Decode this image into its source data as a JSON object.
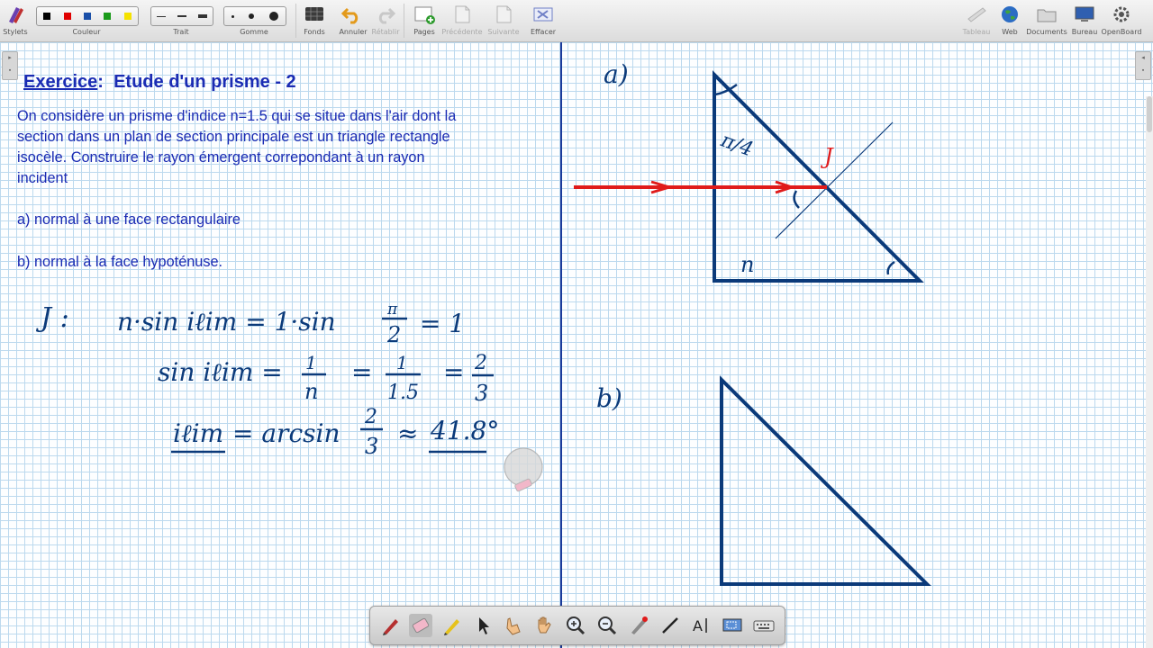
{
  "toolbar": {
    "stylets_label": "Stylets",
    "couleur_label": "Couleur",
    "couleur_swatches": [
      "#000000",
      "#e00000",
      "#1a4fa8",
      "#1a9a1a",
      "#f5e200"
    ],
    "trait_label": "Trait",
    "gomme_label": "Gomme",
    "fonds_label": "Fonds",
    "annuler_label": "Annuler",
    "retablir_label": "Rétablir",
    "pages_label": "Pages",
    "precedente_label": "Précédente",
    "suivante_label": "Suivante",
    "effacer_label": "Effacer",
    "tableau_label": "Tableau",
    "web_label": "Web",
    "documents_label": "Documents",
    "bureau_label": "Bureau",
    "openboard_label": "OpenBoard"
  },
  "exercise": {
    "title_prefix": "Exercice",
    "title_colon": ":",
    "title_rest": "Etude d'un prisme - 2",
    "lines": [
      "On considère un prisme d'indice n=1.5 qui se situe dans l'air dont la",
      "section dans un plan de section principale est un triangle rectangle",
      "isocèle. Construire le rayon émergent correpondant à un rayon",
      "incident"
    ],
    "part_a": "a) normal à une face rectangulaire",
    "part_b": "b) normal à la face hypoténuse."
  },
  "handwriting": {
    "line1_lhs": "J :",
    "line1": "n·sin iℓim = 1·sin",
    "line1_frac_num": "π",
    "line1_frac_den": "2",
    "line1_end": "= 1",
    "line2": "sin iℓim =",
    "line2_f1_num": "1",
    "line2_f1_den": "n",
    "line2_f2_num": "1",
    "line2_f2_den": "1.5",
    "line2_f3_num": "2",
    "line2_f3_den": "3",
    "line3_lhs": "iℓim",
    "line3_mid": "= arcsin",
    "line3_frac_num": "2",
    "line3_frac_den": "3",
    "line3_approx": "≈",
    "line3_result": "41.8°"
  },
  "diagram": {
    "label_a": "a)",
    "label_b": "b)",
    "angle_label": "π/4",
    "index_label": "n",
    "point_label": "J",
    "colors": {
      "ink": "#0b3a7a",
      "ray": "#e01b1b",
      "text": "#1a2bb3"
    }
  },
  "bottombar": {
    "tools": [
      "pen-icon",
      "eraser-icon",
      "marker-icon",
      "pointer-icon",
      "hand-pointer-icon",
      "hand-icon",
      "zoom-in-icon",
      "zoom-out-icon",
      "laser-icon",
      "line-icon",
      "text-icon",
      "capture-icon",
      "keyboard-icon"
    ]
  }
}
